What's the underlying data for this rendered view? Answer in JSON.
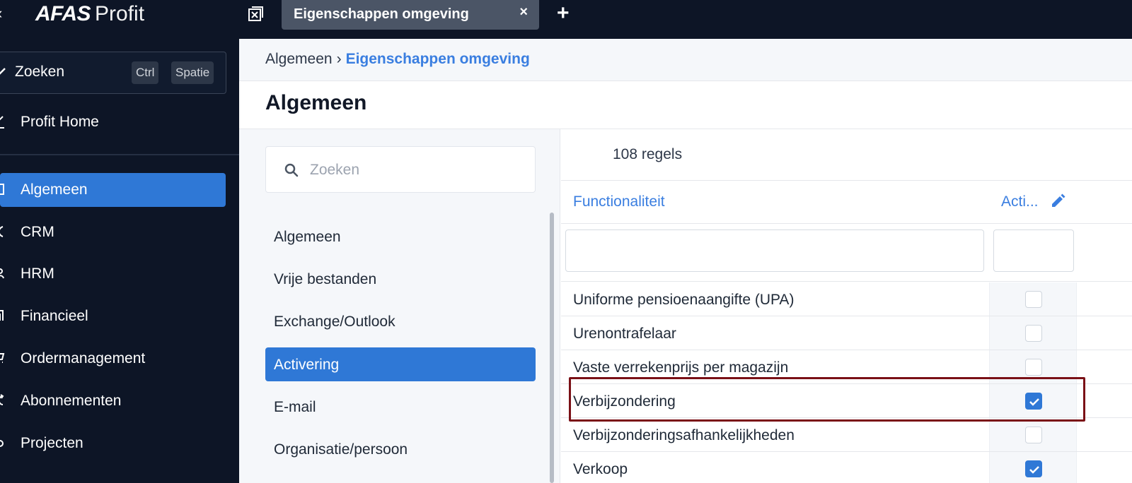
{
  "app": {
    "logo_bold": "AFAS",
    "logo_light": "Profit",
    "tab_title": "Eigenschappen omgeving",
    "tab_close": "×",
    "new_tab": "+",
    "collapse": "‹"
  },
  "sidebar": {
    "search_label": "Zoeken",
    "shortcut_ctrl": "Ctrl",
    "shortcut_space": "Spatie",
    "home_label": "Profit Home",
    "items": [
      {
        "label": "Algemeen",
        "icon": "building-icon",
        "active": true
      },
      {
        "label": "CRM",
        "icon": "crm-icon",
        "active": false
      },
      {
        "label": "HRM",
        "icon": "people-icon",
        "active": false
      },
      {
        "label": "Financieel",
        "icon": "ledger-icon",
        "active": false
      },
      {
        "label": "Ordermanagement",
        "icon": "cart-icon",
        "active": false
      },
      {
        "label": "Abonnementen",
        "icon": "cycle-icon",
        "active": false
      },
      {
        "label": "Projecten",
        "icon": "project-icon",
        "active": false
      }
    ]
  },
  "breadcrumb": {
    "parent": "Algemeen",
    "separator": "›",
    "current": "Eigenschappen omgeving"
  },
  "page": {
    "title": "Algemeen"
  },
  "categories": {
    "search_placeholder": "Zoeken",
    "items": [
      {
        "label": "Algemeen",
        "active": false
      },
      {
        "label": "Vrije bestanden",
        "active": false
      },
      {
        "label": "Exchange/Outlook",
        "active": false
      },
      {
        "label": "Activering",
        "active": true
      },
      {
        "label": "E-mail",
        "active": false
      },
      {
        "label": "Organisatie/persoon",
        "active": false
      }
    ]
  },
  "grid": {
    "row_count": "108 regels",
    "col_functionaliteit": "Functionaliteit",
    "col_actief": "Acti...",
    "rows": [
      {
        "label": "Uniforme pensioenaangifte (UPA)",
        "checked": false
      },
      {
        "label": "Urenontrafelaar",
        "checked": false
      },
      {
        "label": "Vaste verrekenprijs per magazijn",
        "checked": false
      },
      {
        "label": "Verbijzondering",
        "checked": true,
        "highlighted": true
      },
      {
        "label": "Verbijzonderingsafhankelijkheden",
        "checked": false
      },
      {
        "label": "Verkoop",
        "checked": true
      }
    ]
  },
  "colors": {
    "sidebar_bg": "#0d1526",
    "accent": "#2f78d6",
    "link": "#3a7ee0",
    "highlight": "#7a1016"
  }
}
